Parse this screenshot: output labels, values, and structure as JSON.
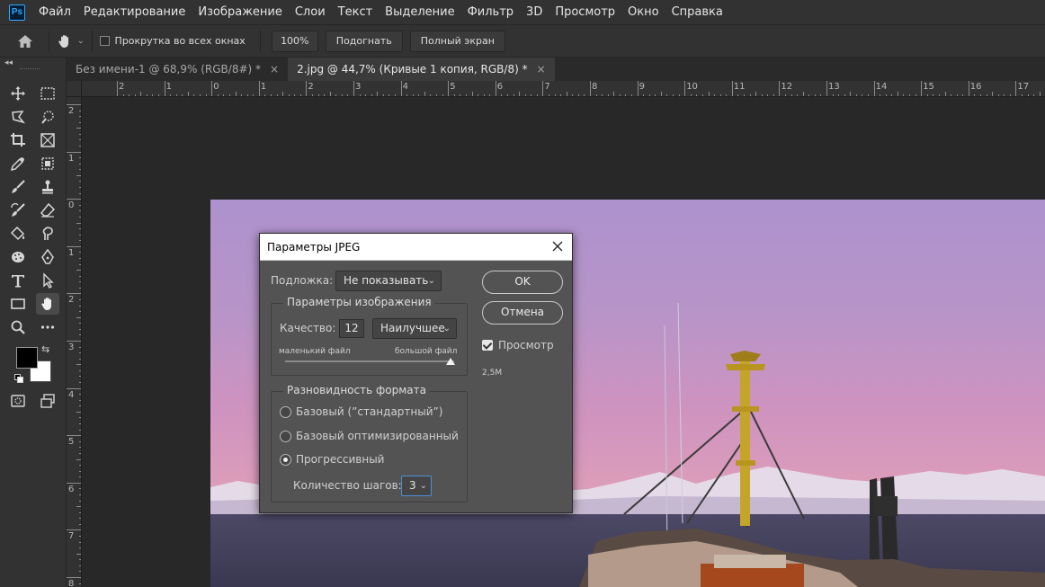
{
  "app": {
    "logo_text": "Ps",
    "menu": [
      "Файл",
      "Редактирование",
      "Изображение",
      "Слои",
      "Текст",
      "Выделение",
      "Фильтр",
      "3D",
      "Просмотр",
      "Окно",
      "Справка"
    ]
  },
  "options_bar": {
    "scroll_all_windows_label": "Прокрутка во всех окнах",
    "zoom_100_label": "100%",
    "fit_label": "Подогнать",
    "fullscreen_label": "Полный экран"
  },
  "tabs": [
    {
      "label": "Без имени-1 @ 68,9% (RGB/8#) *",
      "close": "×",
      "active": false
    },
    {
      "label": "2.jpg @ 44,7% (Кривые 1 копия, RGB/8) *",
      "close": "×",
      "active": true
    }
  ],
  "toolbar": {
    "collapse_glyph": "◂◂",
    "swap_glyph": "⇆"
  },
  "rulers": {
    "horizontal_labels": [
      "2",
      "1",
      "0",
      "1",
      "2",
      "3",
      "4",
      "5",
      "6",
      "7",
      "8",
      "9",
      "10",
      "11",
      "12",
      "13",
      "14",
      "15",
      "16",
      "17"
    ],
    "vertical_labels": [
      "2",
      "1",
      "0",
      "1",
      "2",
      "3",
      "4",
      "5",
      "6",
      "7",
      "8"
    ]
  },
  "colors": {
    "foreground": "#000000",
    "background": "#ffffff",
    "accent": "#31a8ff"
  },
  "dialog": {
    "title": "Параметры JPEG",
    "matte_label": "Подложка:",
    "matte_value": "Не показывать",
    "image_options_title": "Параметры изображения",
    "quality_label": "Качество:",
    "quality_value": "12",
    "quality_preset": "Наилучшее",
    "small_file_label": "маленький файл",
    "large_file_label": "большой файл",
    "quality_slider_fraction": 1.0,
    "format_options_title": "Разновидность формата",
    "format_options": [
      {
        "label": "Базовый (”стандартный”)",
        "selected": false
      },
      {
        "label": "Базовый оптимизированный",
        "selected": false
      },
      {
        "label": "Прогрессивный",
        "selected": true
      }
    ],
    "scans_label": "Количество шагов:",
    "scans_value": "3",
    "ok_label": "OK",
    "cancel_label": "Отмена",
    "preview_label": "Просмотр",
    "preview_checked": true,
    "file_size": "2,5M"
  }
}
